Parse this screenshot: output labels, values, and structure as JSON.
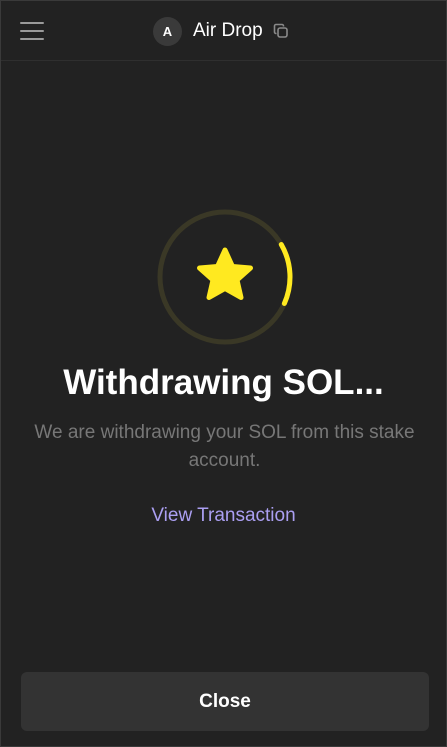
{
  "header": {
    "menu_icon": "hamburger-menu-icon",
    "avatar_letter": "A",
    "account_name": "Air Drop",
    "copy_icon": "copy-icon"
  },
  "status": {
    "icon": "star-icon",
    "progress_fraction": 0.15,
    "title": "Withdrawing SOL...",
    "description": "We are withdrawing your SOL from this stake account.",
    "view_transaction_label": "View Transaction"
  },
  "footer": {
    "close_label": "Close"
  },
  "colors": {
    "background": "#222222",
    "accent_yellow": "#ffe920",
    "ring_track": "#3a3826",
    "link_purple": "#ab9ff2",
    "muted_text": "#777777",
    "button_bg": "#333333"
  }
}
